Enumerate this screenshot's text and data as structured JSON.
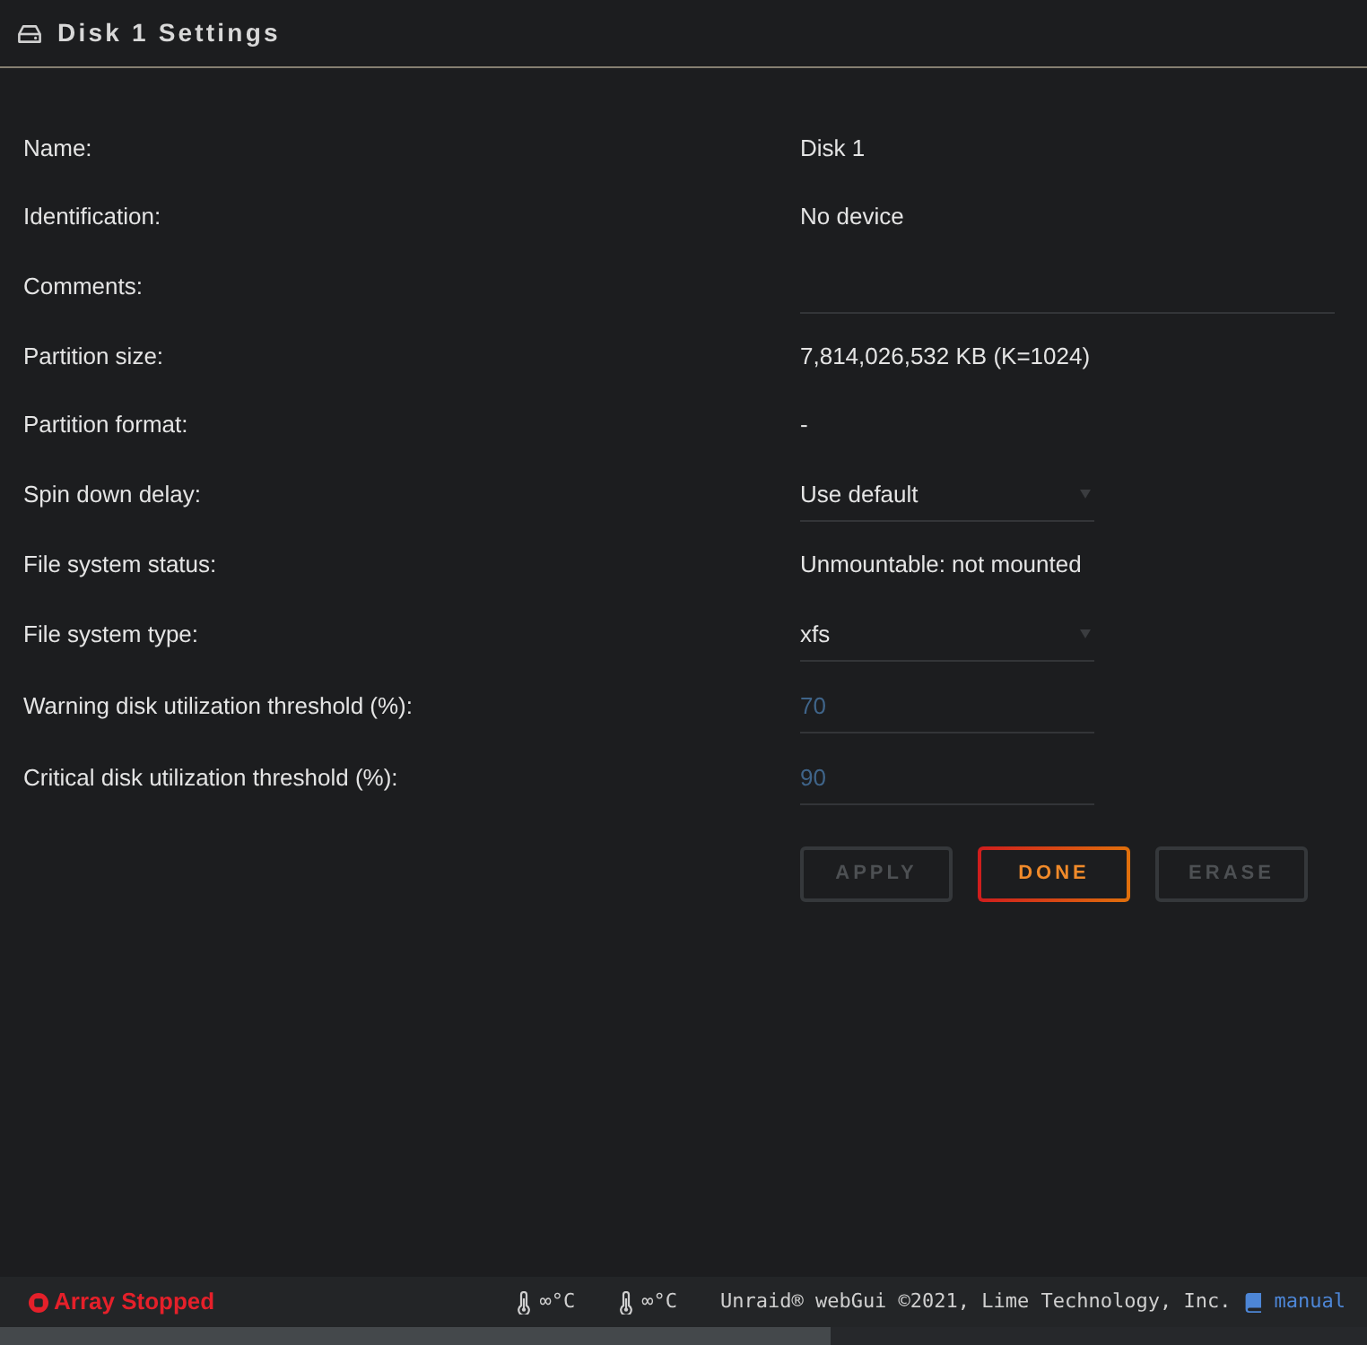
{
  "header": {
    "title": "Disk 1 Settings"
  },
  "fields": [
    {
      "kind": "text",
      "label": "Name:",
      "value": "Disk 1"
    },
    {
      "kind": "text",
      "label": "Identification:",
      "value": "No device"
    },
    {
      "kind": "input",
      "label": "Comments:"
    },
    {
      "kind": "text",
      "label": "Partition size:",
      "value": "7,814,026,532 KB (K=1024)"
    },
    {
      "kind": "text",
      "label": "Partition format:",
      "value": "-"
    },
    {
      "kind": "select",
      "label": "Spin down delay:",
      "value": "Use default"
    },
    {
      "kind": "text",
      "label": "File system status:",
      "value": "Unmountable: not mounted"
    },
    {
      "kind": "select",
      "label": "File system type:",
      "value": "xfs"
    },
    {
      "kind": "number",
      "label": "Warning disk utilization threshold (%):",
      "placeholder": "70"
    },
    {
      "kind": "number",
      "label": "Critical disk utilization threshold (%):",
      "placeholder": "90"
    }
  ],
  "buttons": [
    {
      "label": "APPLY",
      "disabled": true
    },
    {
      "label": "DONE",
      "disabled": false
    },
    {
      "label": "ERASE",
      "disabled": true
    }
  ],
  "status_bar": {
    "array_status": "Array Stopped",
    "temperatures": [
      "∞°C",
      "∞°C"
    ],
    "copyright": "Unraid® webGui ©2021, Lime Technology, Inc.",
    "manual_link": "manual"
  }
}
